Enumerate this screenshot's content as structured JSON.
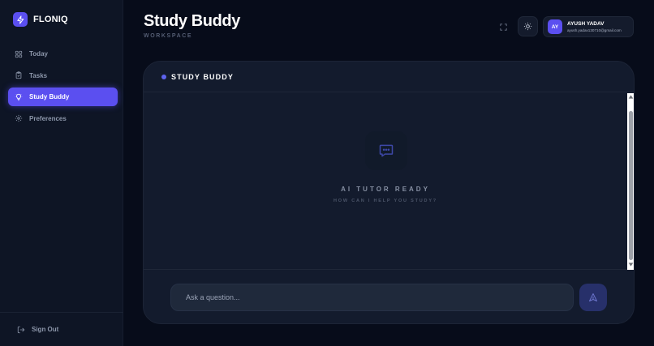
{
  "brand": {
    "name": "FLONIQ",
    "icon": "lightning-bolt-icon"
  },
  "sidebar": {
    "items": [
      {
        "label": "Today",
        "icon": "grid-icon",
        "active": false
      },
      {
        "label": "Tasks",
        "icon": "clipboard-icon",
        "active": false
      },
      {
        "label": "Study Buddy",
        "icon": "lightbulb-icon",
        "active": true
      },
      {
        "label": "Preferences",
        "icon": "gear-icon",
        "active": false
      }
    ],
    "signout_label": "Sign Out",
    "signout_icon": "logout-icon"
  },
  "header": {
    "title": "Study Buddy",
    "subtitle": "WORKSPACE",
    "expand_icon": "expand-icon",
    "theme_icon": "sun-icon"
  },
  "user": {
    "initials": "AY",
    "name": "AYUSH YADAV",
    "email": "ayush.yadav130710@gmail.com"
  },
  "chat": {
    "title": "STUDY BUDDY",
    "empty_icon": "chat-bubble-icon",
    "empty_title": "AI TUTOR READY",
    "empty_subtitle": "HOW CAN I HELP YOU STUDY?",
    "input_placeholder": "Ask a question...",
    "send_icon": "send-icon"
  },
  "colors": {
    "background": "#070c1a",
    "sidebar": "#0e1525",
    "accent": "#5b4ff0",
    "panel": "#131b2d",
    "input": "#1f293b"
  }
}
